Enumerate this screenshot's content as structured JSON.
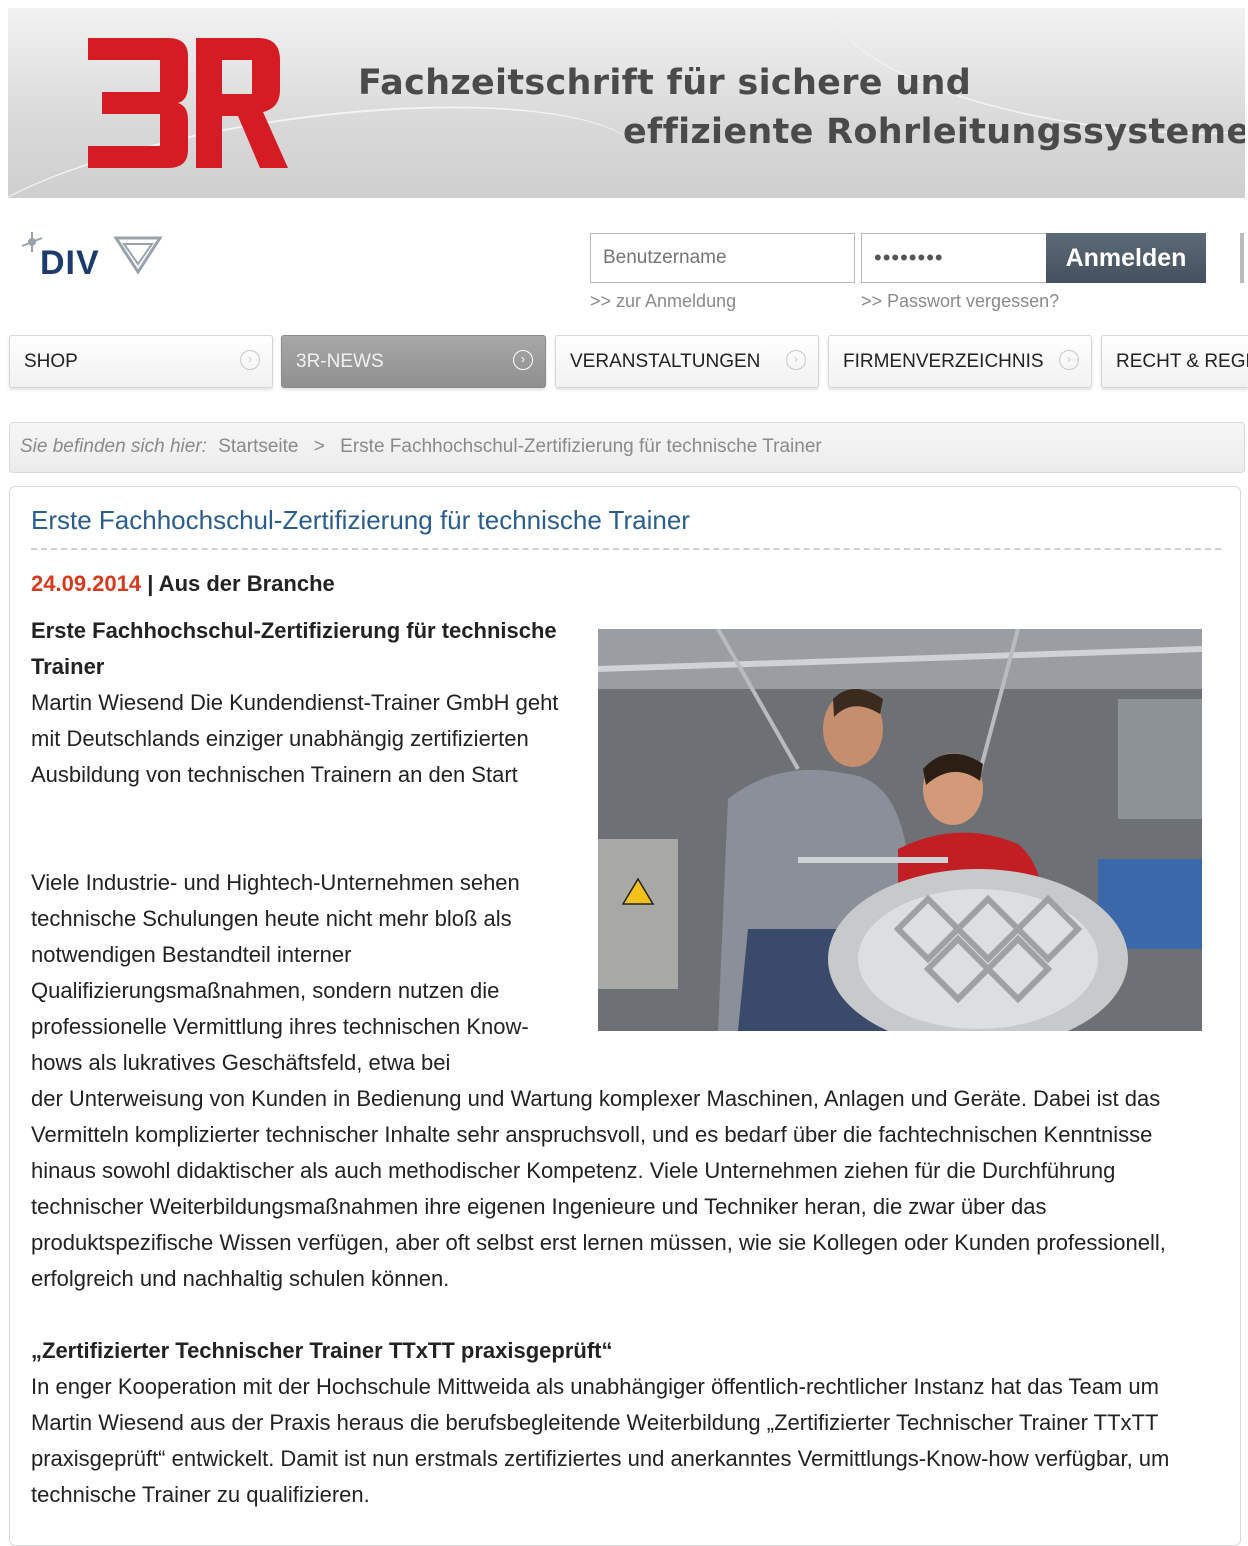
{
  "banner": {
    "logo_text": "3R",
    "tagline_line1": "Fachzeitschrift für sichere und",
    "tagline_line2": "effiziente Rohrleitungssysteme"
  },
  "header": {
    "publisher_logo_text": "DIV",
    "username_placeholder": "Benutzername",
    "password_value": "••••••••",
    "login_button": "Anmelden",
    "login_link": ">> zur Anmeldung",
    "forgot_link": ">> Passwort vergessen?"
  },
  "nav": {
    "items": [
      {
        "label": "SHOP"
      },
      {
        "label": "3R-NEWS"
      },
      {
        "label": "VERANSTALTUNGEN"
      },
      {
        "label": "FIRMENVERZEICHNIS"
      },
      {
        "label": "RECHT & REGELWERK"
      }
    ]
  },
  "breadcrumb": {
    "prefix": "Sie befinden sich hier:",
    "home": "Startseite",
    "separator": ">",
    "current": "Erste Fachhochschul-Zertifizierung für technische Trainer"
  },
  "article": {
    "title": "Erste Fachhochschul-Zertifizierung für technische Trainer",
    "date": "24.09.2014",
    "category": "| Aus der Branche",
    "lead_heading": "Erste Fachhochschul-Zertifizierung für technische Trainer",
    "lead_text": "Martin Wiesend Die Kundendienst-Trainer GmbH geht mit Deutschlands einziger unabhängig zertifizierten Ausbildung von technischen Trainern an den Start",
    "body_wrapped": "Viele Industrie- und Hightech-Unternehmen sehen technische Schulungen heute nicht mehr bloß als notwendigen Bestandteil interner Qualifizierungsmaßnahmen, sondern nutzen die professionelle Vermittlung ihres technischen Know-hows als lukratives Geschäftsfeld, etwa bei",
    "body_full": "der Unterweisung von Kunden in Bedienung und Wartung komplexer Maschinen, Anlagen und Geräte. Dabei ist das Vermitteln komplizierter technischer Inhalte sehr anspruchsvoll, und es bedarf über die fachtechnischen Kenntnisse hinaus sowohl didaktischer als auch methodischer Kompetenz. Viele Unternehmen ziehen für die Durchführung technischer Weiterbildungsmaßnahmen ihre eigenen Ingenieure und Techniker heran, die zwar über das produktspezifische Wissen verfügen, aber oft selbst erst lernen müssen, wie sie Kollegen oder Kunden professionell, erfolgreich und nachhaltig schulen können.",
    "subheading": "„Zertifizierter Technischer Trainer TTxTT praxisgeprüft“",
    "body_last": "In enger Kooperation mit der Hochschule Mittweida als unabhängiger öffentlich-rechtlicher Instanz hat das Team um Martin Wiesend aus der Praxis heraus die berufsbegleitende Weiterbildung „Zertifizierter Technischer Trainer TTxTT praxisgeprüft“ entwickelt. Damit ist nun erstmals zertifiziertes und anerkanntes Vermittlungs-Know-how verfügbar, um technische Trainer zu qualifizieren."
  },
  "colors": {
    "brand_red": "#d51c24",
    "title_blue": "#2a5d8c",
    "date_red": "#d63a1e",
    "button_dark": "#4e5a67"
  }
}
